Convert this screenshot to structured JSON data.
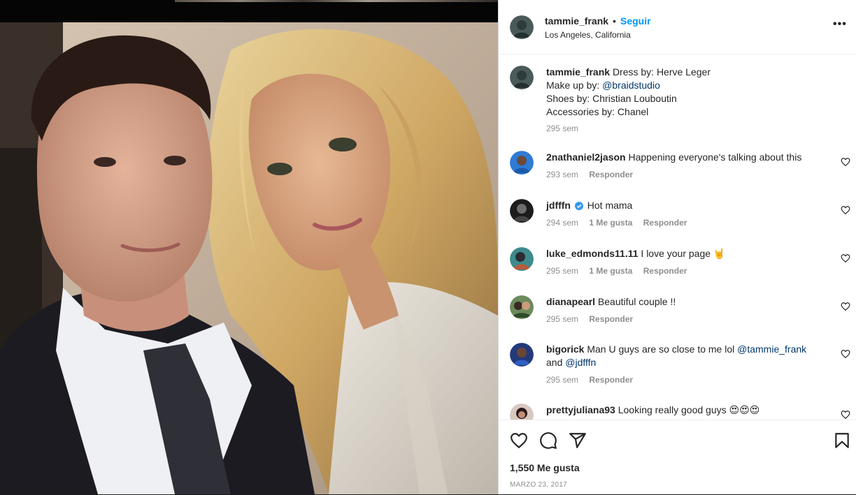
{
  "post": {
    "username": "tammie_frank",
    "separator": "•",
    "follow_label": "Seguir",
    "location": "Los Angeles, California",
    "more_label": "•••"
  },
  "caption": {
    "username": "tammie_frank",
    "line1": "Dress by: Herve Leger",
    "line2_prefix": "Make up by: ",
    "line2_mention": "@braidstudio",
    "line3": "Shoes by: Christian Louboutin",
    "line4": "Accessories by: Chanel",
    "time": "295 sem"
  },
  "comments": [
    {
      "username": "2nathaniel2jason",
      "text": "Happening everyone's talking about this",
      "time": "293 sem",
      "likes": "",
      "reply": "Responder"
    },
    {
      "username": "jdfffn",
      "text": "Hot mama",
      "time": "294 sem",
      "likes": "1 Me gusta",
      "reply": "Responder"
    },
    {
      "username": "luke_edmonds11.11",
      "text": "I love your page 🤘",
      "time": "295 sem",
      "likes": "1 Me gusta",
      "reply": "Responder"
    },
    {
      "username": "dianapearl",
      "text": "Beautiful couple !!",
      "time": "295 sem",
      "likes": "",
      "reply": "Responder"
    },
    {
      "username": "bigorick",
      "text_prefix": "Man U guys are so close to me lol ",
      "mention1": "@tammie_frank",
      "text_mid": "and ",
      "mention2": "@jdfffn",
      "time": "295 sem",
      "likes": "",
      "reply": "Responder"
    },
    {
      "username": "prettyjuliana93",
      "text": "Looking really good guys 😍😍😍",
      "time": "",
      "likes": "",
      "reply": ""
    }
  ],
  "actions": {
    "likes_count": "1,550 Me gusta",
    "date": "MARZO 23, 2017"
  },
  "colors": {
    "link": "#00376b",
    "follow": "#0095f6",
    "meta": "#8e8e8e",
    "text": "#262626",
    "verified": "#3897f0"
  },
  "icons": [
    "heart-icon",
    "comment-icon",
    "share-icon",
    "bookmark-icon",
    "more-options-icon",
    "verified-badge-icon"
  ]
}
